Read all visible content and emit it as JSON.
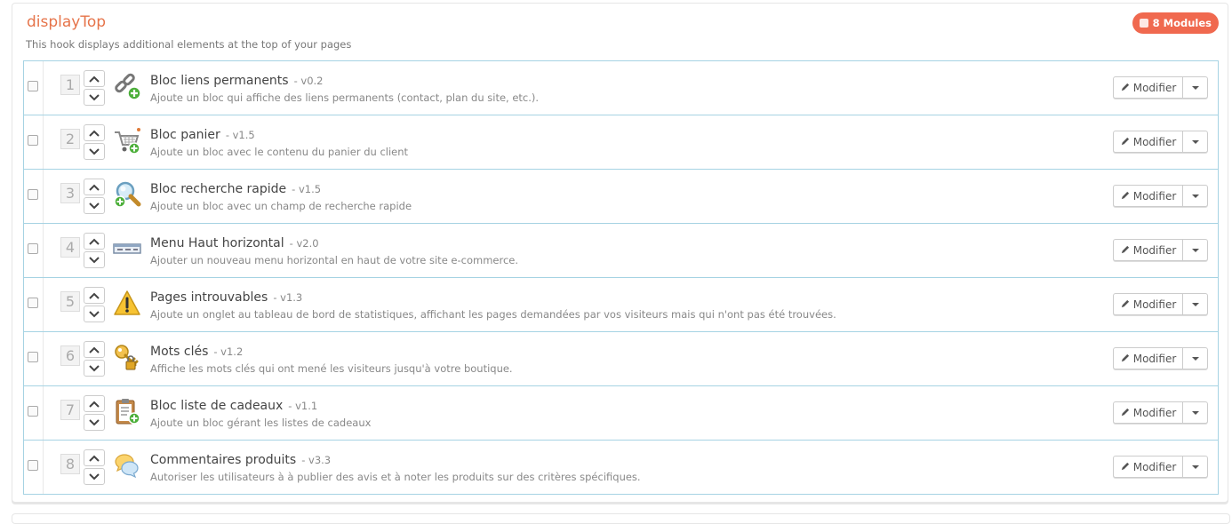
{
  "hook": {
    "title": "displayTop",
    "subtitle": "This hook displays additional elements at the top of your pages",
    "badge": "8 Modules"
  },
  "modules": [
    {
      "position": "1",
      "name": "Bloc liens permanents",
      "version": "- v0.2",
      "description": "Ajoute un bloc qui affiche des liens permanents (contact, plan du site, etc.).",
      "icon": "permalink-icon",
      "action": "Modifier"
    },
    {
      "position": "2",
      "name": "Bloc panier",
      "version": "- v1.5",
      "description": "Ajoute un bloc avec le contenu du panier du client",
      "icon": "cart-icon",
      "action": "Modifier"
    },
    {
      "position": "3",
      "name": "Bloc recherche rapide",
      "version": "- v1.5",
      "description": "Ajoute un bloc avec un champ de recherche rapide",
      "icon": "search-icon",
      "action": "Modifier"
    },
    {
      "position": "4",
      "name": "Menu Haut horizontal",
      "version": "- v2.0",
      "description": "Ajouter un nouveau menu horizontal en haut de votre site e-commerce.",
      "icon": "menu-bar-icon",
      "action": "Modifier"
    },
    {
      "position": "5",
      "name": "Pages introuvables",
      "version": "- v1.3",
      "description": "Ajoute un onglet au tableau de bord de statistiques, affichant les pages demandées par vos visiteurs mais qui n'ont pas été trouvées.",
      "icon": "warning-icon",
      "action": "Modifier"
    },
    {
      "position": "6",
      "name": "Mots clés",
      "version": "- v1.2",
      "description": "Affiche les mots clés qui ont mené les visiteurs jusqu'à votre boutique.",
      "icon": "keys-icon",
      "action": "Modifier"
    },
    {
      "position": "7",
      "name": "Bloc liste de cadeaux",
      "version": "- v1.1",
      "description": "Ajoute un bloc gérant les listes de cadeaux",
      "icon": "clipboard-icon",
      "action": "Modifier"
    },
    {
      "position": "8",
      "name": "Commentaires produits",
      "version": "- v3.3",
      "description": "Autoriser les utilisateurs à à publier des avis et à noter les produits sur des critères spécifiques.",
      "icon": "comments-icon",
      "action": "Modifier"
    }
  ],
  "colors": {
    "accent": "#f0694f",
    "title": "#e6744a",
    "list_border": "#a6d3e3"
  }
}
